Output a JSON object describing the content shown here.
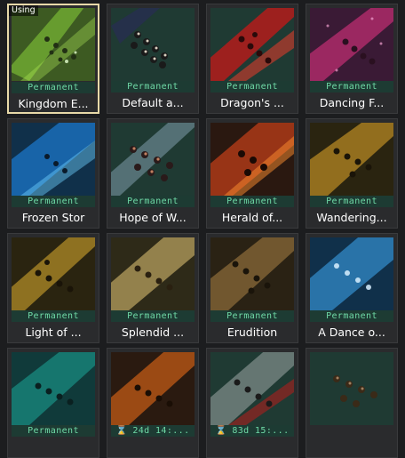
{
  "status_label": "Using",
  "cards": [
    {
      "name": "Kingdom E...",
      "status": "Permanent",
      "using": true,
      "theme": "green"
    },
    {
      "name": "Default a...",
      "status": "Permanent",
      "theme": "default"
    },
    {
      "name": "Dragon's ...",
      "status": "Permanent",
      "theme": "red"
    },
    {
      "name": "Dancing F...",
      "status": "Permanent",
      "theme": "pink"
    },
    {
      "name": "Frozen Stor",
      "status": "Permanent",
      "theme": "blue"
    },
    {
      "name": "Hope of W...",
      "status": "Permanent",
      "theme": "silver"
    },
    {
      "name": "Herald of...",
      "status": "Permanent",
      "theme": "lava"
    },
    {
      "name": "Wandering...",
      "status": "Permanent",
      "theme": "gold"
    },
    {
      "name": "Light of ...",
      "status": "Permanent",
      "theme": "amber"
    },
    {
      "name": "Splendid ...",
      "status": "Permanent",
      "theme": "gold"
    },
    {
      "name": "Erudition",
      "status": "Permanent",
      "theme": "bronze"
    },
    {
      "name": "A Dance o...",
      "status": "Permanent",
      "theme": "sky"
    },
    {
      "name": "",
      "status": "Permanent",
      "theme": "teal"
    },
    {
      "name": "",
      "status": "24d 14:...",
      "timer": true,
      "theme": "orange"
    },
    {
      "name": "",
      "status": "83d 15:...",
      "timer": true,
      "theme": "redwhite"
    },
    {
      "name": "",
      "status": "",
      "theme": "plain"
    }
  ],
  "icons": {
    "timer": "hourglass-icon"
  }
}
